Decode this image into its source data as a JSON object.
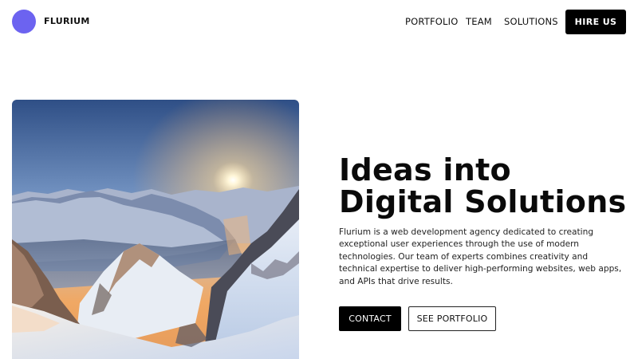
{
  "brand": {
    "name": "FLURIUM",
    "accent_color": "#6c63f0"
  },
  "nav": {
    "items": [
      {
        "label": "PORTFOLIO"
      },
      {
        "label": "TEAM"
      },
      {
        "label": "SOLUTIONS"
      }
    ],
    "cta_label": "HIRE US"
  },
  "hero": {
    "image_icon": "mountain-sunset-photo",
    "headline_line1": "Ideas into",
    "headline_line2": "Digital Solutions",
    "description": "Flurium is a web development agency dedicated to creating exceptional user experiences through the use of modern technologies. Our team of experts combines creativity and technical expertise to deliver high-performing websites, web apps, and APIs that drive results.",
    "primary_button": "CONTACT",
    "secondary_button": "SEE PORTFOLIO"
  }
}
